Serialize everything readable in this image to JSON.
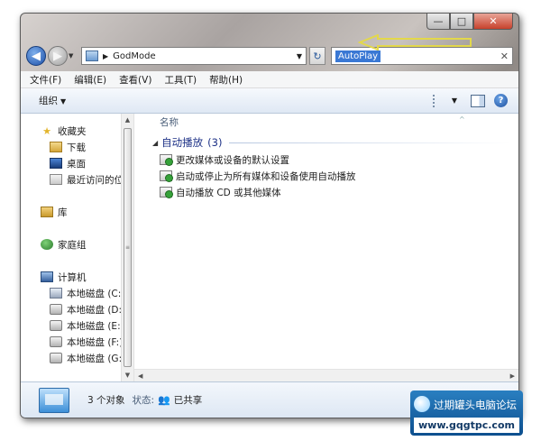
{
  "window": {
    "caption": {
      "minimize": "—",
      "maximize": "□",
      "close": "✕"
    }
  },
  "navbar": {
    "address_path": "GodMode",
    "search_query": "AutoPlay",
    "clear_glyph": "✕",
    "refresh_glyph": "↻"
  },
  "menubar": {
    "items": [
      "文件(F)",
      "编辑(E)",
      "查看(V)",
      "工具(T)",
      "帮助(H)"
    ]
  },
  "toolbar": {
    "organize_label": "组织"
  },
  "navpane": {
    "favorites": "收藏夹",
    "downloads": "下载",
    "desktop": "桌面",
    "recent": "最近访问的位置",
    "libraries": "库",
    "homegroup": "家庭组",
    "computer": "计算机",
    "drives": [
      "本地磁盘 (C:)",
      "本地磁盘 (D:)",
      "本地磁盘 (E:)",
      "本地磁盘 (F:)",
      "本地磁盘 (G:)"
    ]
  },
  "content": {
    "column_name": "名称",
    "group_name": "自动播放",
    "group_count": "(3)",
    "items": [
      "更改媒体或设备的默认设置",
      "启动或停止为所有媒体和设备使用自动播放",
      "自动播放 CD 或其他媒体"
    ]
  },
  "details": {
    "count_text": "3 个对象",
    "state_label": "状态:",
    "state_value": "已共享"
  },
  "watermark": {
    "title": "过期罐头电脑论坛",
    "url": "www.gqgtpc.com"
  },
  "colors": {
    "accent_blue": "#3a78d4",
    "group_header": "#1e3287",
    "annotation_arrow": "#e3d84a"
  }
}
